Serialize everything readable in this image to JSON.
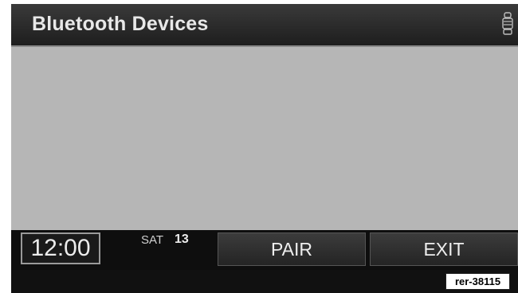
{
  "header": {
    "title": "Bluetooth Devices",
    "status_icon": "vehicle-seat-icon"
  },
  "content": {
    "devices": []
  },
  "footer": {
    "clock": "12:00",
    "day": "SAT",
    "date": "13",
    "pair_label": "PAIR",
    "exit_label": "EXIT"
  },
  "reference_code": "rer-38115",
  "colors": {
    "screen_bg": "#111111",
    "content_bg": "#b6b6b6",
    "text": "#e8e8e8"
  }
}
